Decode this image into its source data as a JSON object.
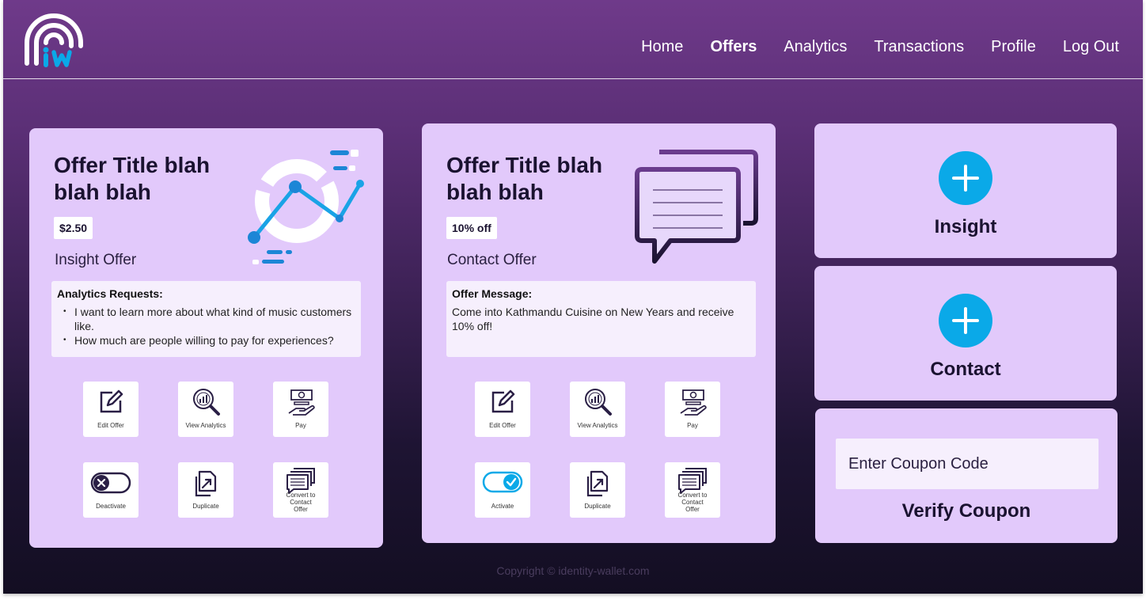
{
  "nav": {
    "items": [
      {
        "label": "Home",
        "active": false
      },
      {
        "label": "Offers",
        "active": true
      },
      {
        "label": "Analytics",
        "active": false
      },
      {
        "label": "Transactions",
        "active": false
      },
      {
        "label": "Profile",
        "active": false
      },
      {
        "label": "Log Out",
        "active": false
      }
    ]
  },
  "offers": [
    {
      "title": "Offer Title blah blah blah",
      "price": "$2.50",
      "type": "Insight Offer",
      "box_heading": "Analytics Requests:",
      "box_items": [
        "I want to learn more about what kind of music customers like.",
        "How much are people willing to pay for experiences?"
      ],
      "actions": {
        "edit": "Edit Offer",
        "analytics": "View Analytics",
        "pay": "Pay",
        "toggle": "Deactivate",
        "duplicate": "Duplicate",
        "convert": "Convert to Contact Offer"
      }
    },
    {
      "title": "Offer Title blah blah blah",
      "price": "10% off",
      "type": "Contact Offer",
      "box_heading": "Offer Message:",
      "box_text": "Come into Kathmandu Cuisine on New Years and receive 10% off!",
      "actions": {
        "edit": "Edit Offer",
        "analytics": "View Analytics",
        "pay": "Pay",
        "toggle": "Activate",
        "duplicate": "Duplicate",
        "convert": "Convert to Contact Offer"
      }
    }
  ],
  "create": {
    "insight_label": "Insight",
    "contact_label": "Contact"
  },
  "coupon": {
    "placeholder": "Enter Coupon Code",
    "verify_label": "Verify Coupon"
  },
  "footer": {
    "copyright": "Copyright © identity-wallet.com"
  },
  "colors": {
    "accent": "#0aa9e8",
    "card": "#e2c9fb",
    "box": "#f6effd",
    "header_top": "#6f3a8a",
    "bottom": "#130e22"
  }
}
